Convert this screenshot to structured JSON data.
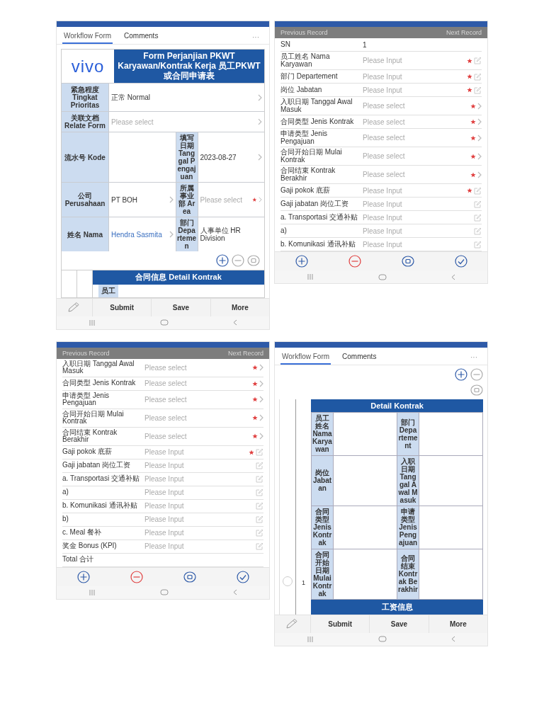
{
  "screens": [
    {
      "kind": "form",
      "tabs": [
        {
          "label": "Workflow Form",
          "selected": true
        },
        {
          "label": "Comments",
          "selected": false
        }
      ],
      "overflow": "···",
      "logo": "vivo",
      "title": "Form Perjanjian PKWT Karyawan/Kontrak Kerja 员工PKWT或合同申请表",
      "rows": [
        [
          {
            "kind": "label",
            "text": "紧急程度 Tingkat Prioritas"
          },
          {
            "kind": "value",
            "text": "正常 Normal",
            "arrow": true
          }
        ],
        [
          {
            "kind": "label",
            "text": "关联文档 Relate Form"
          },
          {
            "kind": "select",
            "placeholder": "Please select",
            "required": false
          }
        ],
        [
          {
            "kind": "label",
            "text": "流水号 Kode"
          },
          {
            "kind": "blank"
          },
          {
            "kind": "narrow",
            "text": "填写日期 Tanggal Pengajuan"
          },
          {
            "kind": "value",
            "text": "2023-08-27",
            "arrow": true
          }
        ],
        [
          {
            "kind": "label",
            "text": "公司 Perusahaan"
          },
          {
            "kind": "value",
            "text": "PT BOH",
            "arrow": true
          },
          {
            "kind": "narrow",
            "text": "所属事业部 Area"
          },
          {
            "kind": "select",
            "placeholder": "Please select",
            "required": true
          }
        ],
        [
          {
            "kind": "label",
            "text": "姓名 Nama"
          },
          {
            "kind": "link",
            "text": "Hendra Sasmita",
            "arrow": true
          },
          {
            "kind": "narrow",
            "text": "部门 Departemen"
          },
          {
            "kind": "value",
            "text": "人事单位 HR Division",
            "arrow": false
          }
        ]
      ],
      "section": {
        "title": "合同信息 Detail Kontrak",
        "cell": "员工"
      },
      "actions": [
        "Submit",
        "Save",
        "More"
      ]
    },
    {
      "kind": "record",
      "previous": "Previous Record",
      "next": "Next Record",
      "rows": [
        {
          "kind": "text",
          "label": "SN",
          "value": "1"
        },
        {
          "kind": "input",
          "label": "员工姓名 Nama Karyawan",
          "placeholder": "Please Input",
          "required": true
        },
        {
          "kind": "input",
          "label": "部门 Departement",
          "placeholder": "Please Input",
          "required": true
        },
        {
          "kind": "input",
          "label": "岗位 Jabatan",
          "placeholder": "Please Input",
          "required": true
        },
        {
          "kind": "select",
          "label": "入职日期 Tanggal Awal Masuk",
          "placeholder": "Please select",
          "required": true
        },
        {
          "kind": "select",
          "label": "合同类型 Jenis Kontrak",
          "placeholder": "Please select",
          "required": true
        },
        {
          "kind": "select",
          "label": "申请类型 Jenis Pengajuan",
          "placeholder": "Please select",
          "required": true
        },
        {
          "kind": "select",
          "label": "合同开始日期 Mulai Kontrak",
          "placeholder": "Please select",
          "required": true
        },
        {
          "kind": "select",
          "label": "合同结束 Kontrak Berakhir",
          "placeholder": "Please select",
          "required": true
        },
        {
          "kind": "input",
          "label": "Gaji pokok 底薪",
          "placeholder": "Please Input",
          "required": true
        },
        {
          "kind": "input",
          "label": "Gaji jabatan 岗位工资",
          "placeholder": "Please Input",
          "required": false
        },
        {
          "kind": "input",
          "label": "a. Transportasi 交通补贴",
          "placeholder": "Please Input",
          "required": false
        },
        {
          "kind": "input",
          "label": "a)",
          "placeholder": "Please Input",
          "required": false
        },
        {
          "kind": "input",
          "label": "b. Komunikasi 通讯补贴",
          "placeholder": "Please Input",
          "required": false
        }
      ]
    },
    {
      "kind": "record",
      "previous": "Previous Record",
      "next": "Next Record",
      "rows": [
        {
          "kind": "select",
          "label": "入职日期 Tanggal Awal Masuk",
          "placeholder": "Please select",
          "required": true
        },
        {
          "kind": "select",
          "label": "合同类型 Jenis Kontrak",
          "placeholder": "Please select",
          "required": true
        },
        {
          "kind": "select",
          "label": "申请类型 Jenis Pengajuan",
          "placeholder": "Please select",
          "required": true
        },
        {
          "kind": "select",
          "label": "合同开始日期 Mulai Kontrak",
          "placeholder": "Please select",
          "required": true
        },
        {
          "kind": "select",
          "label": "合同结束 Kontrak Berakhir",
          "placeholder": "Please select",
          "required": true
        },
        {
          "kind": "input",
          "label": "Gaji pokok 底薪",
          "placeholder": "Please Input",
          "required": true
        },
        {
          "kind": "input",
          "label": "Gaji jabatan 岗位工资",
          "placeholder": "Please Input",
          "required": false
        },
        {
          "kind": "input",
          "label": "a. Transportasi 交通补贴",
          "placeholder": "Please Input",
          "required": false
        },
        {
          "kind": "input",
          "label": "a)",
          "placeholder": "Please Input",
          "required": false
        },
        {
          "kind": "input",
          "label": "b. Komunikasi 通讯补贴",
          "placeholder": "Please Input",
          "required": false
        },
        {
          "kind": "input",
          "label": "b)",
          "placeholder": "Please Input",
          "required": false
        },
        {
          "kind": "input",
          "label": "c. Meal 餐补",
          "placeholder": "Please Input",
          "required": false
        },
        {
          "kind": "input",
          "label": "奖金 Bonus (KPI)",
          "placeholder": "Please Input",
          "required": false
        },
        {
          "kind": "text",
          "label": "Total 合计"
        }
      ]
    },
    {
      "kind": "detail",
      "tabs": [
        {
          "label": "Workflow Form",
          "selected": true
        },
        {
          "label": "Comments",
          "selected": false
        }
      ],
      "overflow": "···",
      "row": {
        "index": "1",
        "selected": false
      },
      "title": "Detail Kontrak",
      "fields": [
        [
          "员工姓名 Nama Karyawan",
          "部门 Departement"
        ],
        [
          "岗位 Jabatan",
          "入职日期 Tanggal Awal Masuk"
        ],
        [
          "合同类型 Jenis Kontrak",
          "申请类型 Jenis Pengajuan"
        ],
        [
          "合同开始日期 Mulai Kontrak",
          "合同结束 Kontrak Berakhir"
        ]
      ],
      "footer": "工资信息",
      "actions": [
        "Submit",
        "Save",
        "More"
      ]
    }
  ]
}
